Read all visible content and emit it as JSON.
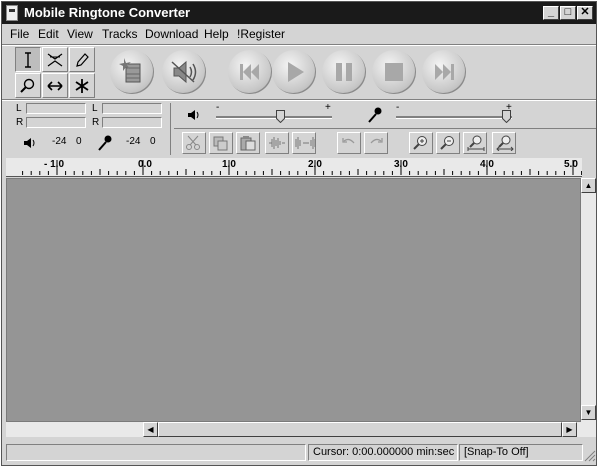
{
  "window": {
    "title": "Mobile Ringtone Converter",
    "controls": {
      "minimize": "_",
      "maximize": "□",
      "close": "✕"
    }
  },
  "menubar": {
    "items": [
      "File",
      "Edit",
      "View",
      "Tracks",
      "Download",
      "Help",
      "!Register"
    ]
  },
  "tools": {
    "items": [
      "selection-tool",
      "envelope-tool",
      "draw-tool",
      "zoom-tool",
      "time-shift-tool",
      "multi-tool"
    ],
    "active": "selection-tool"
  },
  "transport": {
    "items": [
      "effects-button",
      "mute-button",
      "skip-to-start-button",
      "play-button",
      "pause-button",
      "stop-button",
      "skip-to-end-button"
    ]
  },
  "meters": {
    "output": {
      "left_label": "L",
      "right_label": "R",
      "scale_low": "-24",
      "scale_high": "0"
    },
    "input": {
      "left_label": "L",
      "right_label": "R",
      "scale_low": "-24",
      "scale_high": "0"
    }
  },
  "mixer": {
    "output_volume": {
      "minus": "-",
      "plus": "+",
      "level": 0.55
    },
    "input_volume": {
      "minus": "-",
      "plus": "+",
      "level": 0.95
    }
  },
  "edit_toolbar": {
    "items": [
      "cut-icon",
      "copy-icon",
      "paste-icon",
      "trim-icon",
      "silence-icon",
      "undo-icon",
      "redo-icon",
      "zoom-in-icon",
      "zoom-out-icon",
      "fit-selection-icon",
      "fit-project-icon"
    ]
  },
  "ruler": {
    "labels": [
      "- 1.0",
      "0.0",
      "1.0",
      "2.0",
      "3.0",
      "4.0",
      "5.0"
    ]
  },
  "scrollbars": {
    "up": "▲",
    "down": "▼",
    "left": "◀",
    "right": "▶"
  },
  "statusbar": {
    "message": "",
    "cursor": "Cursor: 0:00.000000 min:sec",
    "snap": "[Snap-To Off]"
  },
  "colors": {
    "titlebar": "#1a1a1a",
    "chrome": "#d4d4d4",
    "track_area": "#959595"
  }
}
